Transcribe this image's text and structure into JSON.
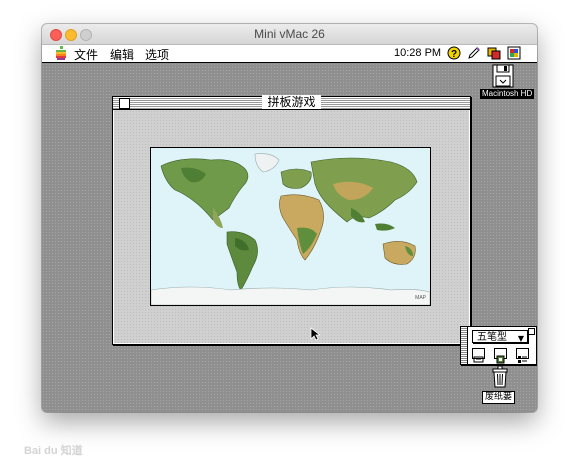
{
  "host_window": {
    "title": "Mini vMac 26"
  },
  "menubar": {
    "items": [
      {
        "label": "文件"
      },
      {
        "label": "编辑"
      },
      {
        "label": "选项"
      }
    ],
    "clock": "10:28 PM",
    "right_icons": [
      "help-icon",
      "pencil-icon",
      "app-switch-icon",
      "keyboard-layout-icon"
    ]
  },
  "desktop": {
    "disk_label": "Macintosh HD",
    "trash_label": "废纸篓"
  },
  "puzzle_window": {
    "title": "拼板游戏",
    "picture": "world-map"
  },
  "ime_palette": {
    "selected": "五笔型",
    "buttons": [
      "ime-mode-icon",
      "ime-dictionary-icon",
      "ime-settings-icon"
    ]
  },
  "watermark": "Bai du 知道"
}
